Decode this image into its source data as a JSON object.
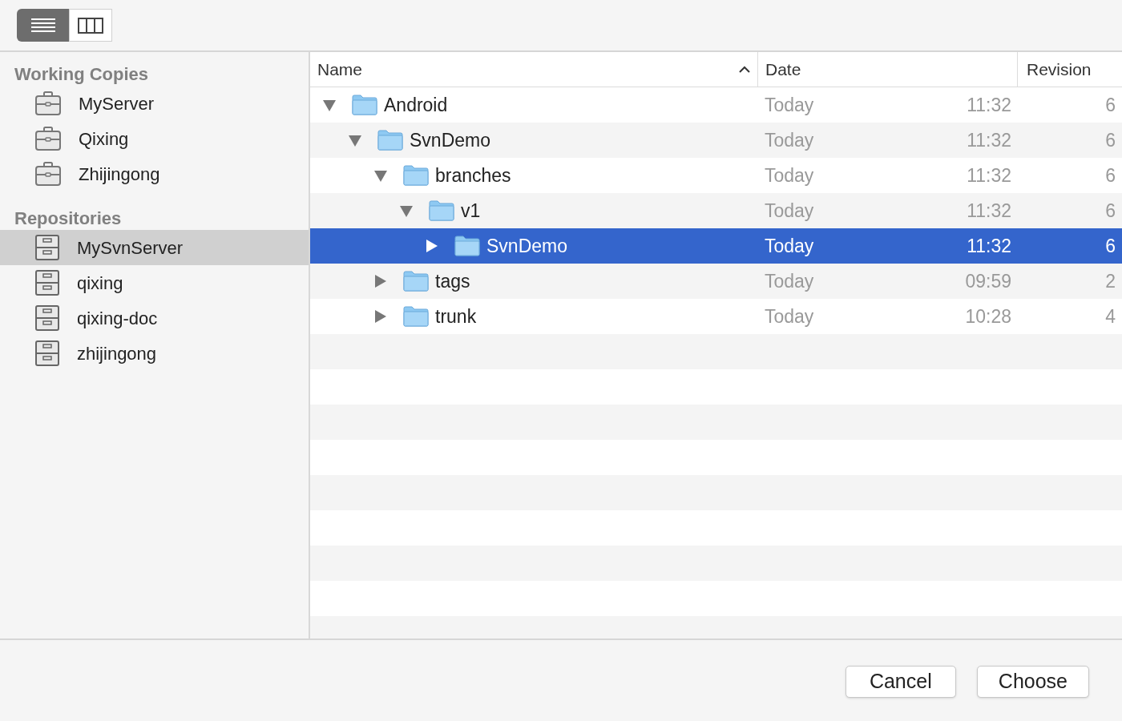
{
  "toolbar": {
    "view_modes": [
      {
        "kind": "list",
        "selected": true
      },
      {
        "kind": "columns",
        "selected": false
      }
    ]
  },
  "sidebar": {
    "sections": [
      {
        "title": "Working Copies",
        "kind": "working-copy",
        "items": [
          {
            "label": "MyServer",
            "selected": false
          },
          {
            "label": "Qixing",
            "selected": false
          },
          {
            "label": "Zhijingong",
            "selected": false
          }
        ]
      },
      {
        "title": "Repositories",
        "kind": "repository",
        "items": [
          {
            "label": "MySvnServer",
            "selected": true
          },
          {
            "label": "qixing",
            "selected": false
          },
          {
            "label": "qixing-doc",
            "selected": false
          },
          {
            "label": "zhijingong",
            "selected": false
          }
        ]
      }
    ]
  },
  "table": {
    "columns": [
      {
        "label": "Name",
        "sorted": true
      },
      {
        "label": "Date",
        "sorted": false
      },
      {
        "label": "Revision",
        "sorted": false
      }
    ],
    "rows": [
      {
        "name": "Android",
        "date": "Today",
        "time": "11:32",
        "revision": "6",
        "expanded": true,
        "selected": false,
        "children": [
          {
            "name": "SvnDemo",
            "date": "Today",
            "time": "11:32",
            "revision": "6",
            "expanded": true,
            "selected": false,
            "children": [
              {
                "name": "branches",
                "date": "Today",
                "time": "11:32",
                "revision": "6",
                "expanded": true,
                "selected": false,
                "children": [
                  {
                    "name": "v1",
                    "date": "Today",
                    "time": "11:32",
                    "revision": "6",
                    "expanded": true,
                    "selected": false,
                    "children": [
                      {
                        "name": "SvnDemo",
                        "date": "Today",
                        "time": "11:32",
                        "revision": "6",
                        "expanded": false,
                        "selected": true
                      }
                    ]
                  }
                ]
              },
              {
                "name": "tags",
                "date": "Today",
                "time": "09:59",
                "revision": "2",
                "expanded": false,
                "selected": false
              },
              {
                "name": "trunk",
                "date": "Today",
                "time": "10:28",
                "revision": "4",
                "expanded": false,
                "selected": false
              }
            ]
          }
        ]
      }
    ]
  },
  "buttons": [
    {
      "label": "Cancel"
    },
    {
      "label": "Choose"
    }
  ]
}
